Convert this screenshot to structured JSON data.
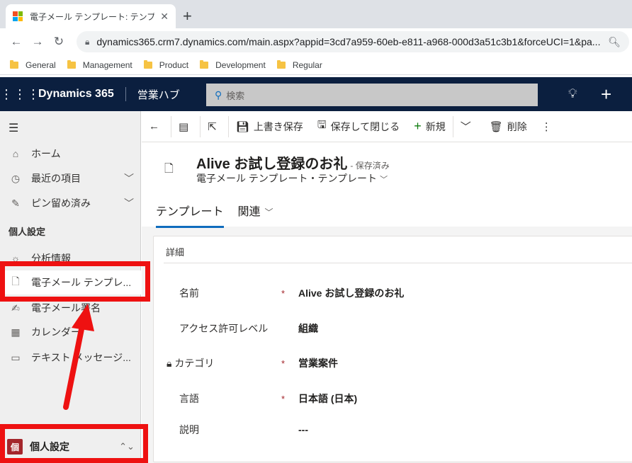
{
  "browser": {
    "tab_title": "電子メール テンプレート: テンプレート: A",
    "tab_close_icon": "✕",
    "new_tab_icon": "+",
    "url": "dynamics365.crm7.dynamics.com/main.aspx?appid=3cd7a959-60eb-e811-a968-000d3a51c3b1&forceUCI=1&pa...",
    "bookmarks": [
      "General",
      "Management",
      "Product",
      "Development",
      "Regular"
    ]
  },
  "header": {
    "app_name": "Dynamics 365",
    "hub_name": "営業ハブ",
    "search_placeholder": "検索"
  },
  "sidebar": {
    "items": [
      {
        "label": "ホーム",
        "icon": "home-icon"
      },
      {
        "label": "最近の項目",
        "icon": "clock-icon"
      },
      {
        "label": "ピン留め済み",
        "icon": "pin-icon"
      }
    ],
    "group_label": "個人設定",
    "settings_items": [
      {
        "label": "分析情報",
        "icon": "insights-icon"
      },
      {
        "label": "電子メール テンプレ...",
        "icon": "document-icon"
      },
      {
        "label": "電子メール署名",
        "icon": "signature-icon"
      },
      {
        "label": "カレンダー",
        "icon": "calendar-icon"
      },
      {
        "label": "テキスト メッセージ...",
        "icon": "message-icon"
      }
    ],
    "area_badge": "個",
    "area_label": "個人設定"
  },
  "commands": {
    "save": "上書き保存",
    "save_close": "保存して閉じる",
    "new": "新規",
    "delete": "削除"
  },
  "record": {
    "title": "Alive お試し登録のお礼",
    "status": "- 保存済み",
    "entity": "電子メール テンプレート・テンプレート",
    "tabs": [
      {
        "label": "テンプレート"
      },
      {
        "label": "関連"
      }
    ]
  },
  "section": {
    "title": "詳細",
    "fields": [
      {
        "label": "名前",
        "required": "*",
        "value": "Alive お試し登録のお礼"
      },
      {
        "label": "アクセス許可レベル",
        "required": "",
        "value": "組織"
      },
      {
        "label": "カテゴリ",
        "required": "*",
        "value": "営業案件"
      },
      {
        "label": "言語",
        "required": "*",
        "value": "日本語 (日本)"
      },
      {
        "label": "説明",
        "required": "",
        "value": "---"
      }
    ]
  },
  "annotation_color": "#ee1111"
}
